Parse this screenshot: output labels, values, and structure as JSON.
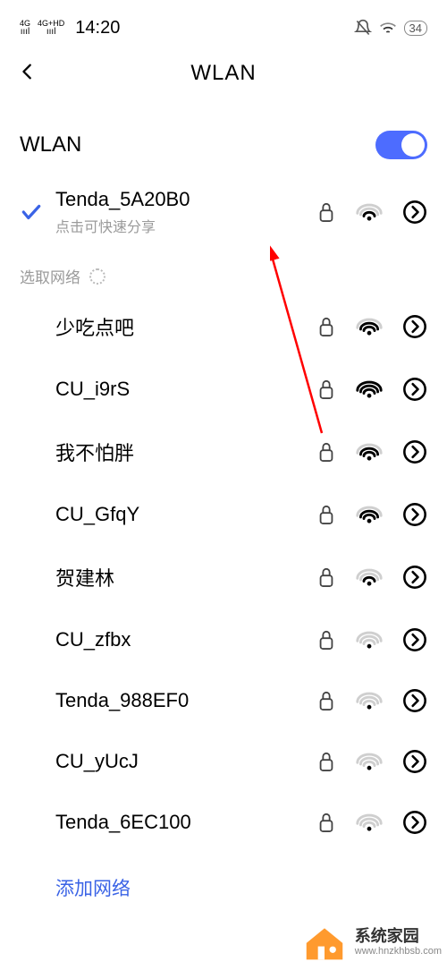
{
  "status": {
    "signal1": "4G",
    "signal2": "4G+HD",
    "time": "14:20",
    "battery": "34"
  },
  "header": {
    "title": "WLAN"
  },
  "wlan": {
    "label": "WLAN",
    "enabled": true
  },
  "connected": {
    "ssid": "Tenda_5A20B0",
    "hint": "点击可快速分享",
    "locked": true,
    "signal": 2
  },
  "group_label": "选取网络",
  "networks": [
    {
      "ssid": "少吃点吧",
      "locked": true,
      "signal": 3
    },
    {
      "ssid": "CU_i9rS",
      "locked": true,
      "signal": 4
    },
    {
      "ssid": "我不怕胖",
      "locked": true,
      "signal": 3
    },
    {
      "ssid": "CU_GfqY",
      "locked": true,
      "signal": 3
    },
    {
      "ssid": "贺建林",
      "locked": true,
      "signal": 2
    },
    {
      "ssid": "CU_zfbx",
      "locked": true,
      "signal": 1
    },
    {
      "ssid": "Tenda_988EF0",
      "locked": true,
      "signal": 1
    },
    {
      "ssid": "CU_yUcJ",
      "locked": true,
      "signal": 1
    },
    {
      "ssid": "Tenda_6EC100",
      "locked": true,
      "signal": 1
    }
  ],
  "add_network_label": "添加网络",
  "watermark": {
    "title": "系统家园",
    "url": "www.hnzkhbsb.com"
  }
}
